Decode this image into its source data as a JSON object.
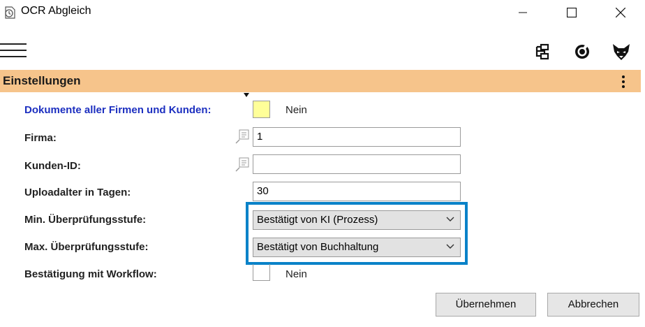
{
  "window": {
    "title": "OCR Abgleich"
  },
  "section": {
    "title": "Einstellungen"
  },
  "form": {
    "docs_all": {
      "label": "Dokumente aller Firmen und Kunden:",
      "value": "Nein"
    },
    "firma": {
      "label": "Firma:",
      "value": "1"
    },
    "kunden_id": {
      "label": "Kunden-ID:",
      "value": ""
    },
    "uploadalter": {
      "label": "Uploadalter in Tagen:",
      "value": "30"
    },
    "min_stufe": {
      "label": "Min. Überprüfungsstufe:",
      "value": "Bestätigt von KI (Prozess)"
    },
    "max_stufe": {
      "label": "Max. Überprüfungsstufe:",
      "value": "Bestätigt von Buchhaltung"
    },
    "workflow": {
      "label": "Bestätigung mit Workflow:",
      "value": "Nein"
    }
  },
  "buttons": {
    "ok": "Übernehmen",
    "cancel": "Abbrechen"
  },
  "colors": {
    "section_bg": "#f6c48b",
    "highlight": "#0a82c8",
    "checkbox_yellow": "#ffff99",
    "link_blue": "#1c2fc0"
  },
  "icons": {
    "app": "clock-document-icon",
    "minimize": "minimize-icon",
    "maximize": "maximize-icon",
    "close": "close-icon",
    "menu": "hamburger-menu-icon",
    "hierarchy": "hierarchy-icon",
    "help": "help-circle-icon",
    "fox": "fox-logo-icon",
    "more": "more-vertical-icon",
    "lookup": "lookup-list-icon",
    "chevron": "chevron-down-icon"
  }
}
